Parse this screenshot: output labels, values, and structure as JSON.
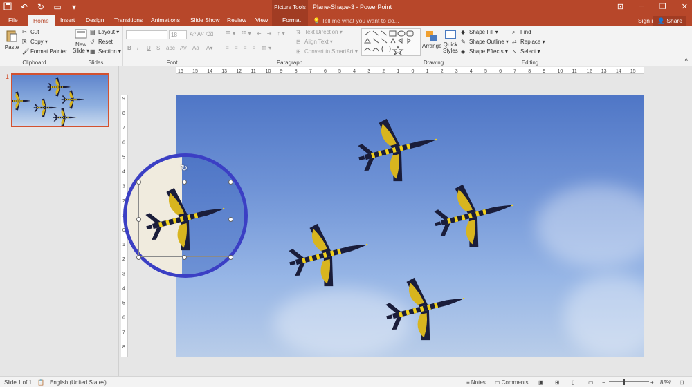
{
  "titlebar": {
    "picture_tools": "Picture Tools",
    "doc_title": "Plane-Shape-3 - PowerPoint",
    "qat_icons": [
      "save-icon",
      "undo-icon",
      "redo-icon",
      "present-icon",
      "customize-icon"
    ],
    "window_controls": [
      "─",
      "❐",
      "✕"
    ]
  },
  "tabs": {
    "file": "File",
    "home": "Home",
    "insert": "Insert",
    "design": "Design",
    "transitions": "Transitions",
    "animations": "Animations",
    "slideshow": "Slide Show",
    "review": "Review",
    "view": "View",
    "format": "Format",
    "tellme": "Tell me what you want to do...",
    "signin": "Sign in",
    "share": "Share"
  },
  "ribbon": {
    "clipboard": {
      "label": "Clipboard",
      "paste": "Paste",
      "cut": "Cut",
      "copy": "Copy",
      "format_painter": "Format Painter"
    },
    "slides": {
      "label": "Slides",
      "new_slide": "New",
      "new_slide2": "Slide",
      "layout": "Layout",
      "reset": "Reset",
      "section": "Section"
    },
    "font": {
      "label": "Font",
      "font_name": "",
      "font_size": "18",
      "bold": "B",
      "italic": "I",
      "underline": "U",
      "strike": "S",
      "shadow": "abc",
      "spacing": "AV",
      "case": "Aa"
    },
    "paragraph": {
      "label": "Paragraph",
      "text_direction": "Text Direction",
      "align_text": "Align Text",
      "smartart": "Convert to SmartArt"
    },
    "drawing": {
      "label": "Drawing",
      "arrange": "Arrange",
      "quick": "Quick",
      "styles": "Styles",
      "shape_fill": "Shape Fill",
      "shape_outline": "Shape Outline",
      "shape_effects": "Shape Effects"
    },
    "editing": {
      "label": "Editing",
      "find": "Find",
      "replace": "Replace",
      "select": "Select"
    }
  },
  "thumbs": {
    "slide_number": "1"
  },
  "ruler": {
    "h_ticks": [
      "16",
      "15",
      "14",
      "13",
      "12",
      "11",
      "10",
      "9",
      "8",
      "7",
      "6",
      "5",
      "4",
      "3",
      "2",
      "1",
      "0",
      "1",
      "2",
      "3",
      "4",
      "5",
      "6",
      "7",
      "8",
      "9",
      "10",
      "11",
      "12",
      "13",
      "14",
      "15",
      "16"
    ],
    "v_ticks": [
      "9",
      "8",
      "7",
      "6",
      "5",
      "4",
      "3",
      "2",
      "1",
      "0",
      "1",
      "2",
      "3",
      "4",
      "5",
      "6",
      "7",
      "8",
      "9"
    ]
  },
  "status": {
    "slide": "Slide 1 of 1",
    "language": "English (United States)",
    "notes": "Notes",
    "comments": "Comments",
    "zoom": "85%"
  },
  "colors": {
    "accent": "#b7472a",
    "selection_circle": "#3b3fc4"
  }
}
